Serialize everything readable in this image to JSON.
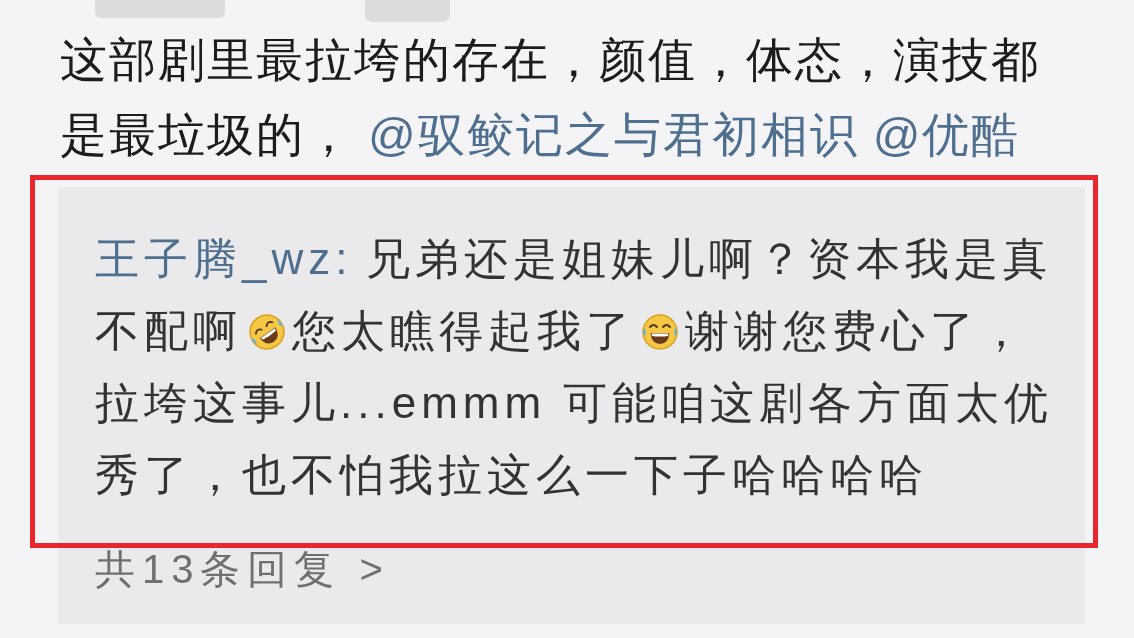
{
  "comment": {
    "segments": [
      {
        "kind": "text",
        "text": "这部剧里最拉垮的存在，颜值，体态，演技都是最垃圾的，"
      },
      {
        "kind": "mention",
        "text": "@驭鲛记之与君初相识"
      },
      {
        "kind": "mention",
        "text": "@优酷"
      }
    ]
  },
  "reply": {
    "segments": [
      {
        "kind": "author",
        "text": "王子腾_wz:"
      },
      {
        "kind": "text",
        "text": "兄弟还是姐妹儿啊？资本我是真不配啊"
      },
      {
        "kind": "emoji",
        "tilted": true
      },
      {
        "kind": "text",
        "text": "您太瞧得起我了"
      },
      {
        "kind": "emoji",
        "tilted": false
      },
      {
        "kind": "text",
        "text": "谢谢您费心了，拉垮这事儿...emmm 可能咱这剧各方面太优秀了，也不怕我拉这么一下子哈哈哈哈"
      }
    ]
  },
  "replies_link": "共13条回复 >"
}
